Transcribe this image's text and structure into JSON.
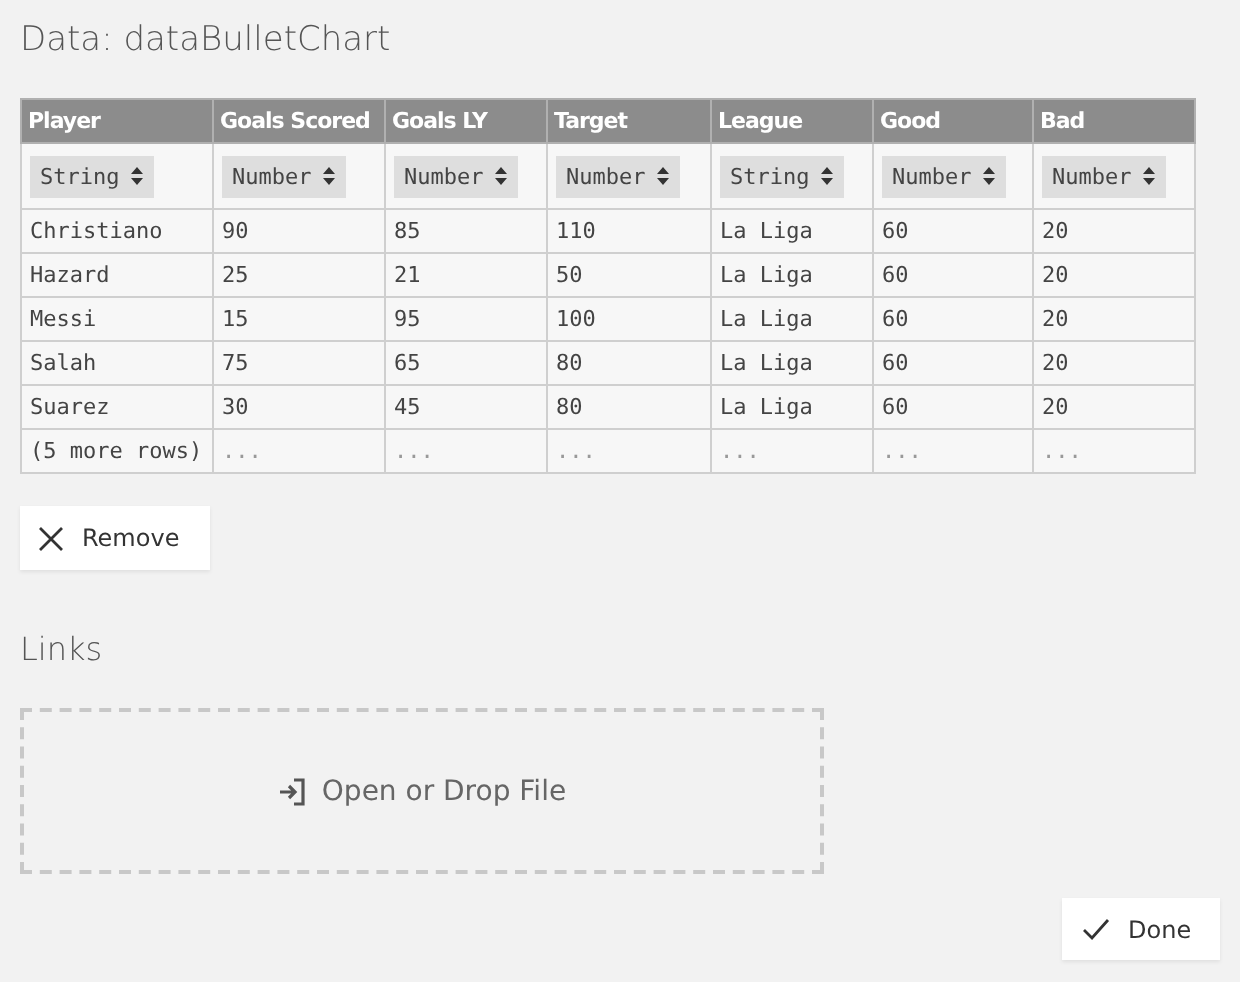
{
  "title": "Data: dataBulletChart",
  "table": {
    "columns": [
      {
        "name": "Player",
        "type": "String"
      },
      {
        "name": "Goals Scored",
        "type": "Number"
      },
      {
        "name": "Goals LY",
        "type": "Number"
      },
      {
        "name": "Target",
        "type": "Number"
      },
      {
        "name": "League",
        "type": "String"
      },
      {
        "name": "Good",
        "type": "Number"
      },
      {
        "name": "Bad",
        "type": "Number"
      }
    ],
    "rows": [
      [
        "Christiano",
        "90",
        "85",
        "110",
        "La Liga",
        "60",
        "20"
      ],
      [
        "Hazard",
        "25",
        "21",
        "50",
        "La Liga",
        "60",
        "20"
      ],
      [
        "Messi",
        "15",
        "95",
        "100",
        "La Liga",
        "60",
        "20"
      ],
      [
        "Salah",
        "75",
        "65",
        "80",
        "La Liga",
        "60",
        "20"
      ],
      [
        "Suarez",
        "30",
        "45",
        "80",
        "La Liga",
        "60",
        "20"
      ],
      [
        "(5 more rows)",
        "...",
        "...",
        "...",
        "...",
        "...",
        "..."
      ]
    ]
  },
  "remove_button": "Remove",
  "links_heading": "Links",
  "drop_zone": "Open or Drop File",
  "done_button": "Done"
}
